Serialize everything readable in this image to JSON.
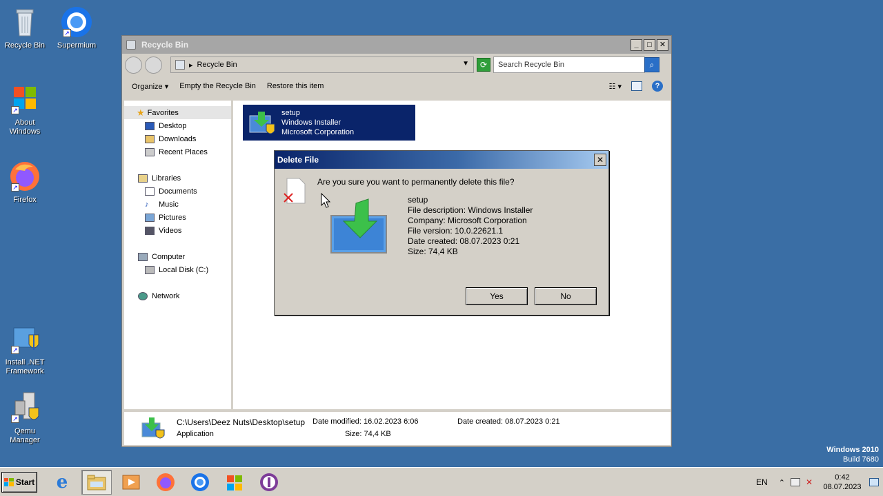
{
  "desktop": {
    "icons": [
      {
        "label": "Recycle Bin",
        "icon": "recycle-bin-icon"
      },
      {
        "label": "Supermium",
        "icon": "supermium-browser-icon"
      },
      {
        "label": "About Windows",
        "icon": "windows-logo-icon"
      },
      {
        "label": "Firefox",
        "icon": "firefox-icon"
      },
      {
        "label": "Install .NET Framework",
        "icon": "dotnet-installer-icon"
      },
      {
        "label": "Qemu Manager",
        "icon": "qemu-manager-icon"
      }
    ],
    "brand_line1": "Windows 2010",
    "brand_line2": "Build 7680"
  },
  "explorer": {
    "title": "Recycle Bin",
    "address": "Recycle Bin",
    "search_placeholder": "Search Recycle Bin",
    "toolbar": {
      "organize": "Organize",
      "empty": "Empty the Recycle Bin",
      "restore": "Restore this item"
    },
    "nav": {
      "favorites": "Favorites",
      "desktop": "Desktop",
      "downloads": "Downloads",
      "recent": "Recent Places",
      "libraries": "Libraries",
      "documents": "Documents",
      "music": "Music",
      "pictures": "Pictures",
      "videos": "Videos",
      "computer": "Computer",
      "local_disk": "Local Disk (C:)",
      "network": "Network"
    },
    "file": {
      "name": "setup",
      "type": "Windows Installer",
      "company": "Microsoft Corporation"
    },
    "details": {
      "path": "C:\\Users\\Deez Nuts\\Desktop\\setup",
      "kind": "Application",
      "modified": "Date modified:  16.02.2023 6:06",
      "size": "Size:  74,4 KB",
      "created": "Date created:  08.07.2023 0:21"
    }
  },
  "dialog": {
    "title": "Delete File",
    "question": "Are you sure you want to permanently delete this file?",
    "name": "setup",
    "description": "File description: Windows Installer",
    "company": "Company: Microsoft Corporation",
    "version": "File version: 10.0.22621.1",
    "created": "Date created: 08.07.2023 0:21",
    "size": "Size: 74,4 KB",
    "yes": "Yes",
    "no": "No"
  },
  "taskbar": {
    "start": "Start",
    "lang": "EN",
    "time": "0:42",
    "date": "08.07.2023"
  }
}
